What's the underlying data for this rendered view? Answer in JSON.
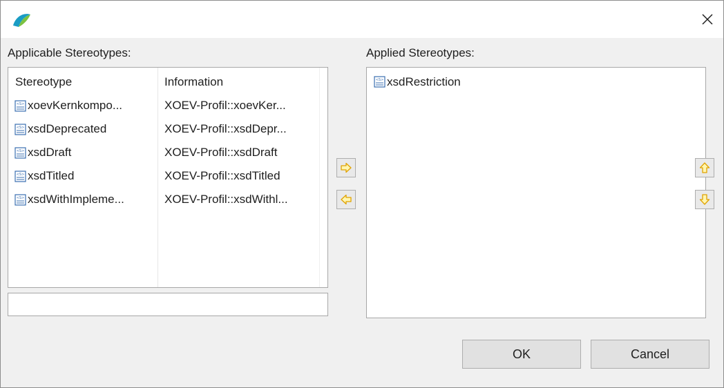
{
  "labels": {
    "applicable": "Applicable Stereotypes:",
    "applied": "Applied Stereotypes:"
  },
  "table": {
    "headers": {
      "stereotype": "Stereotype",
      "information": "Information"
    },
    "rows": [
      {
        "name": "xoevKernkompo...",
        "info": "XOEV-Profil::xoevKer..."
      },
      {
        "name": "xsdDeprecated",
        "info": "XOEV-Profil::xsdDepr..."
      },
      {
        "name": "xsdDraft",
        "info": "XOEV-Profil::xsdDraft"
      },
      {
        "name": "xsdTitled",
        "info": "XOEV-Profil::xsdTitled"
      },
      {
        "name": "xsdWithImpleme...",
        "info": "XOEV-Profil::xsdWithl..."
      }
    ]
  },
  "filter": {
    "value": ""
  },
  "applied_list": [
    {
      "name": "xsdRestriction"
    }
  ],
  "buttons": {
    "ok": "OK",
    "cancel": "Cancel"
  },
  "colors": {
    "arrow_fill": "#fff6b0",
    "arrow_stroke": "#e0a200",
    "icon_blue": "#3a6fb0"
  },
  "icons": {
    "stereotype": "stereotype-icon",
    "add": "arrow-right-icon",
    "remove": "arrow-left-icon",
    "up": "arrow-up-icon",
    "down": "arrow-down-icon",
    "close": "close-icon",
    "logo": "app-logo-icon"
  }
}
